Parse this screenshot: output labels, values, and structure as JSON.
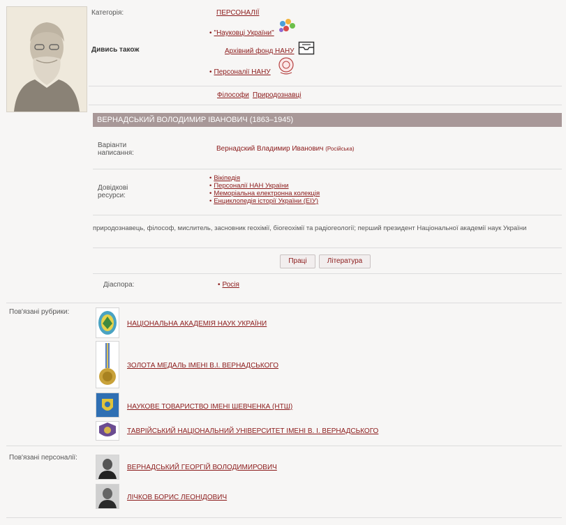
{
  "top": {
    "category_label": "Категорія:",
    "category_value": "ПЕРСОНАЛІЇ",
    "see_also_label": "Дивись також",
    "see_also": [
      {
        "label": "\"Науковці України\"",
        "icon": "people-network-icon"
      },
      {
        "label": "Архівний фонд НАНУ",
        "icon": "archive-box-icon"
      },
      {
        "label": "Персоналії НАНУ",
        "icon": "nanu-emblem-icon"
      }
    ],
    "tags": [
      "Філософи",
      "Природознавці"
    ]
  },
  "title": "ВЕРНАДСЬКИЙ ВОЛОДИМИР ІВАНОВИЧ (1863–1945)",
  "variants": {
    "label_line1": "Варіанти",
    "label_line2": "написання:",
    "value": "Вернадский Владимир Иванович",
    "lang": "(Російська)"
  },
  "references": {
    "label_line1": "Довідкові",
    "label_line2": "ресурси:",
    "items": [
      "Вікіпедія",
      "Персоналії НАН України",
      "Меморіальна електронна колекція",
      "Енциклопедія історії України (ЕІУ)"
    ]
  },
  "description": "природознавець, філософ, мислитель, засновник геохімії, біогеохімії та радіогеології; перший президент Національної академії наук України",
  "buttons": {
    "works": "Праці",
    "literature": "Література"
  },
  "diaspora": {
    "label": "Діаспора:",
    "value": "Росія"
  },
  "related_rubrics": {
    "label": "Пов'язані рубрики:",
    "items": [
      "НАЦІОНАЛЬНА АКАДЕМІЯ НАУК УКРАЇНИ",
      "ЗОЛОТА МЕДАЛЬ ІМЕНІ В.І. ВЕРНАДСЬКОГО",
      "НАУКОВЕ ТОВАРИСТВО ІМЕНІ ШЕВЧЕНКА (НТШ)",
      "ТАВРІЙСЬКИЙ НАЦІОНАЛЬНИЙ УНІВЕРСИТЕТ ІМЕНІ В. І. ВЕРНАДСЬКОГО"
    ]
  },
  "related_persons": {
    "label": "Пов'язані персоналії:",
    "items": [
      "ВЕРНАДСЬКИЙ ГЕОРГІЙ ВОЛОДИМИРОВИЧ",
      "ЛІЧКОВ БОРИС ЛЕОНІДОВИЧ"
    ]
  }
}
